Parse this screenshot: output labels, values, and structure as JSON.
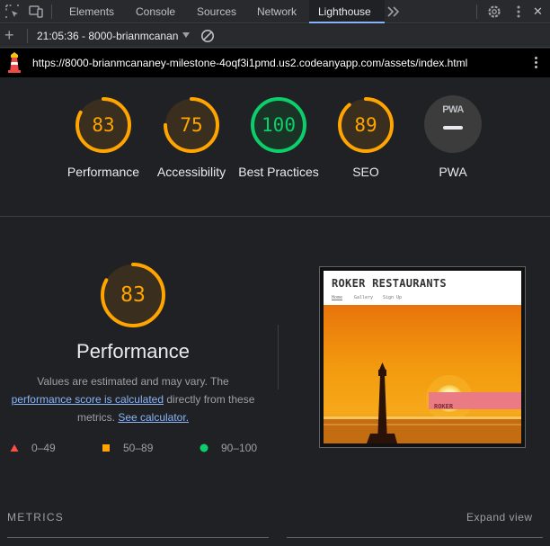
{
  "devtools": {
    "tabs": [
      {
        "label": "Elements"
      },
      {
        "label": "Console"
      },
      {
        "label": "Sources"
      },
      {
        "label": "Network"
      },
      {
        "label": "Lighthouse",
        "active": true
      }
    ],
    "icons": [
      "inspect-icon",
      "device-toolbar-icon",
      "more-tabs-icon",
      "settings-icon",
      "kebab-icon",
      "close-icon"
    ],
    "close_glyph": "✕"
  },
  "toolbar": {
    "report_select": "21:05:36 - 8000-brianmcanan"
  },
  "urlbar": {
    "url": "https://8000-brianmcananey-milestone-4oqf3i1pmd.us2.codeanyapp.com/assets/index.html"
  },
  "colors": {
    "average": "#ffa400",
    "pass": "#0cce6b",
    "fail": "#ff4e42",
    "link": "#8ab4f8"
  },
  "summary": [
    {
      "score": 83,
      "label": "Performance",
      "status": "average"
    },
    {
      "score": 75,
      "label": "Accessibility",
      "status": "average"
    },
    {
      "score": 100,
      "label": "Best Practices",
      "status": "pass"
    },
    {
      "score": 89,
      "label": "SEO",
      "status": "average"
    },
    {
      "badge": "PWA",
      "label": "PWA",
      "status": "na"
    }
  ],
  "detail": {
    "score": 83,
    "title": "Performance",
    "desc_1": "Values are estimated and may vary. The",
    "desc_link1": "performance score is calculated",
    "desc_2": " directly from these",
    "desc_3": "metrics. ",
    "desc_link2": "See calculator.",
    "legend": [
      {
        "range": "0–49",
        "shape": "triangle",
        "status": "fail"
      },
      {
        "range": "50–89",
        "shape": "square",
        "status": "average"
      },
      {
        "range": "90–100",
        "shape": "circle",
        "status": "pass"
      }
    ]
  },
  "screenshot": {
    "site_title": "ROKER RESTAURANTS",
    "nav": [
      "Home",
      "Gallery",
      "Sign Up"
    ],
    "caption": "ROKER"
  },
  "metrics": {
    "heading": "METRICS",
    "expand_label": "Expand view"
  }
}
